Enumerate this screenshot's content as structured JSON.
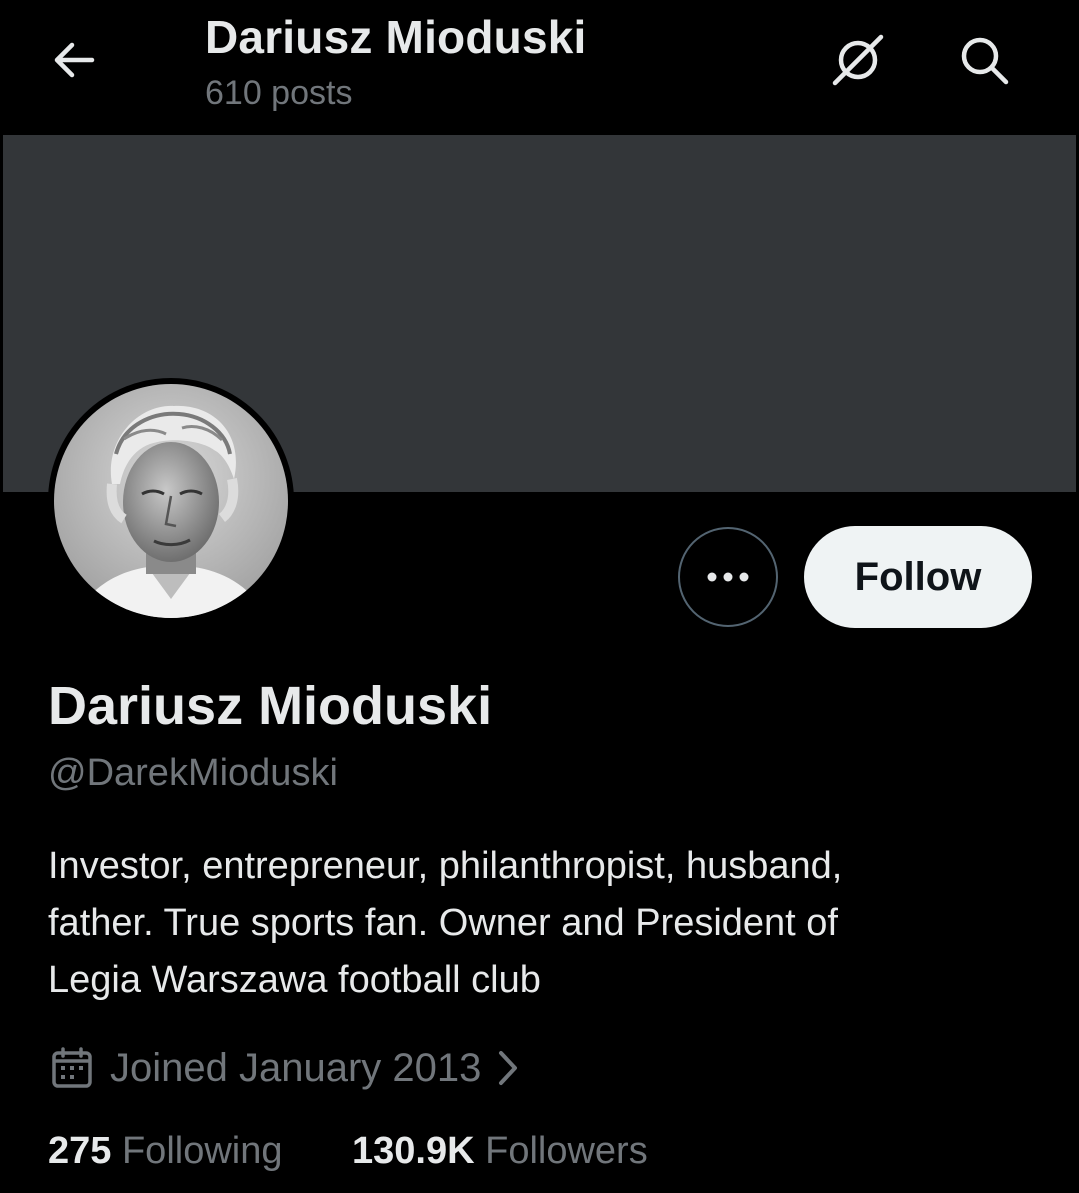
{
  "header": {
    "title": "Dariusz Mioduski",
    "post_count": "610 posts",
    "back_icon": "arrow-left-icon",
    "grok_icon": "grok-icon",
    "search_icon": "search-icon"
  },
  "profile": {
    "display_name": "Dariusz Mioduski",
    "handle": "@DarekMioduski",
    "bio_lines": [
      "Investor, entrepreneur, philanthropist, husband,",
      "father. True sports fan. Owner and President of",
      "Legia Warszawa football club"
    ],
    "joined": "Joined January 2013",
    "following_count": "275",
    "following_label": "Following",
    "followers_count": "130.9K",
    "followers_label": "Followers"
  },
  "actions": {
    "more_label": "•••",
    "follow_label": "Follow"
  },
  "colors": {
    "background": "#000000",
    "banner": "#333639",
    "primary_text": "#e7e9ea",
    "secondary_text": "#71767b",
    "follow_bg": "#eff3f4"
  }
}
